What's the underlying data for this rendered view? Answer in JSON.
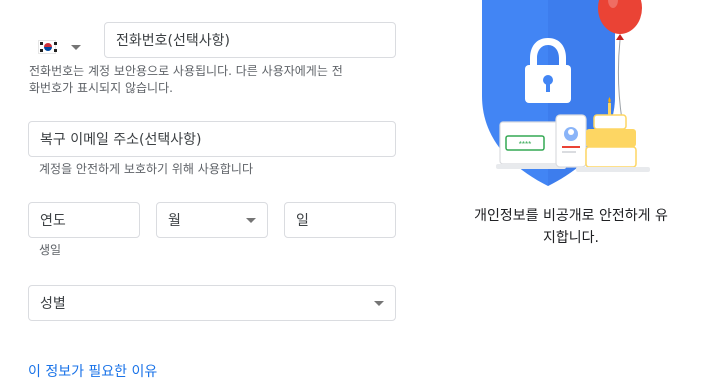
{
  "phone": {
    "country_flag": "kr-flag-icon",
    "label": "전화번호(선택사항)",
    "helper": "전화번호는 계정 보안용으로 사용됩니다. 다른 사용자에게는 전",
    "helper_line2": "화번호가 표시되지 않습니다."
  },
  "recovery_email": {
    "label": "복구 이메일 주소(선택사항)",
    "helper": "계정을 안전하게 보호하기 위해 사용합니다"
  },
  "birthday": {
    "year_label": "연도",
    "month_label": "월",
    "day_label": "일",
    "helper": "생일"
  },
  "gender": {
    "label": "성별"
  },
  "why_link": "이 정보가 필요한 이유",
  "illustration": {
    "caption_line1": "개인정보를 비공개로 안전하게 유",
    "caption_line2": "지합니다.",
    "password_text": "****",
    "colors": {
      "shield": "#4285f4",
      "balloon": "#ea4335",
      "cake": "#fdd663",
      "lock": "#ffffff"
    }
  }
}
